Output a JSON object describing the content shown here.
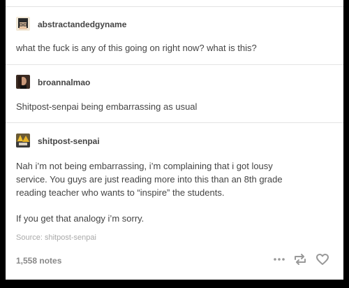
{
  "posts": [
    {
      "username": "abstractandedgyname",
      "body": [
        "what the fuck is any of this going on right now? what is this?"
      ]
    },
    {
      "username": "broannalmao",
      "body": [
        "Shitpost-senpai being embarrassing as usual"
      ]
    },
    {
      "username": "shitpost-senpai",
      "body": [
        "Nah i’m not being embarrassing, i’m complaining that i got lousy",
        "service. You guys are just reading more into this than an 8th grade",
        "reading teacher who wants to “inspire” the students."
      ],
      "body2": "If you get that analogy i’m sorry."
    }
  ],
  "footer": {
    "source": "Source: shitpost-senpai",
    "notes": "1,558 notes",
    "icons": [
      "more-icon",
      "reblog-icon",
      "heart-icon"
    ]
  },
  "colors": {
    "text": "#444444",
    "muted": "#888888",
    "divider": "#e3e3e3",
    "background": "#000000"
  }
}
